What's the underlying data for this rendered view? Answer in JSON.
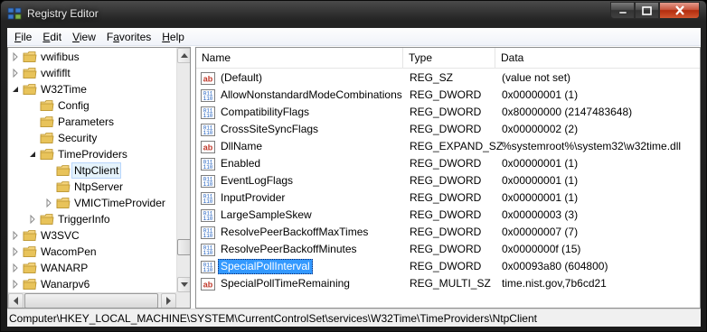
{
  "window": {
    "title": "Registry Editor",
    "caption_buttons": [
      "minimize",
      "maximize",
      "close"
    ]
  },
  "menu": [
    {
      "underline": "F",
      "rest": "ile"
    },
    {
      "underline": "E",
      "rest": "dit"
    },
    {
      "underline": "V",
      "rest": "iew"
    },
    {
      "pre": "F",
      "underline": "a",
      "rest": "vorites"
    },
    {
      "underline": "H",
      "rest": "elp"
    }
  ],
  "tree": {
    "items": [
      {
        "label": "vwifibus",
        "depth": 0,
        "expander": "collapsed"
      },
      {
        "label": "vwififlt",
        "depth": 0,
        "expander": "collapsed"
      },
      {
        "label": "W32Time",
        "depth": 0,
        "expander": "expanded"
      },
      {
        "label": "Config",
        "depth": 1,
        "expander": "none"
      },
      {
        "label": "Parameters",
        "depth": 1,
        "expander": "none"
      },
      {
        "label": "Security",
        "depth": 1,
        "expander": "none"
      },
      {
        "label": "TimeProviders",
        "depth": 1,
        "expander": "expanded"
      },
      {
        "label": "NtpClient",
        "depth": 2,
        "expander": "none",
        "selected": true
      },
      {
        "label": "NtpServer",
        "depth": 2,
        "expander": "none"
      },
      {
        "label": "VMICTimeProvider",
        "depth": 2,
        "expander": "collapsed"
      },
      {
        "label": "TriggerInfo",
        "depth": 1,
        "expander": "collapsed"
      },
      {
        "label": "W3SVC",
        "depth": 0,
        "expander": "collapsed"
      },
      {
        "label": "WacomPen",
        "depth": 0,
        "expander": "collapsed"
      },
      {
        "label": "WANARP",
        "depth": 0,
        "expander": "collapsed"
      },
      {
        "label": "Wanarpv6",
        "depth": 0,
        "expander": "collapsed"
      }
    ]
  },
  "list": {
    "columns": [
      "Name",
      "Type",
      "Data"
    ],
    "rows": [
      {
        "icon": "string-value-icon",
        "name": "(Default)",
        "type": "REG_SZ",
        "data": "(value not set)"
      },
      {
        "icon": "binary-value-icon",
        "name": "AllowNonstandardModeCombinations",
        "type": "REG_DWORD",
        "data": "0x00000001 (1)"
      },
      {
        "icon": "binary-value-icon",
        "name": "CompatibilityFlags",
        "type": "REG_DWORD",
        "data": "0x80000000 (2147483648)"
      },
      {
        "icon": "binary-value-icon",
        "name": "CrossSiteSyncFlags",
        "type": "REG_DWORD",
        "data": "0x00000002 (2)"
      },
      {
        "icon": "string-value-icon",
        "name": "DllName",
        "type": "REG_EXPAND_SZ",
        "data": "%systemroot%\\system32\\w32time.dll"
      },
      {
        "icon": "binary-value-icon",
        "name": "Enabled",
        "type": "REG_DWORD",
        "data": "0x00000001 (1)"
      },
      {
        "icon": "binary-value-icon",
        "name": "EventLogFlags",
        "type": "REG_DWORD",
        "data": "0x00000001 (1)"
      },
      {
        "icon": "binary-value-icon",
        "name": "InputProvider",
        "type": "REG_DWORD",
        "data": "0x00000001 (1)"
      },
      {
        "icon": "binary-value-icon",
        "name": "LargeSampleSkew",
        "type": "REG_DWORD",
        "data": "0x00000003 (3)"
      },
      {
        "icon": "binary-value-icon",
        "name": "ResolvePeerBackoffMaxTimes",
        "type": "REG_DWORD",
        "data": "0x00000007 (7)"
      },
      {
        "icon": "binary-value-icon",
        "name": "ResolvePeerBackoffMinutes",
        "type": "REG_DWORD",
        "data": "0x0000000f (15)"
      },
      {
        "icon": "binary-value-icon",
        "name": "SpecialPollInterval",
        "type": "REG_DWORD",
        "data": "0x00093a80 (604800)",
        "selected": true
      },
      {
        "icon": "string-value-icon",
        "name": "SpecialPollTimeRemaining",
        "type": "REG_MULTI_SZ",
        "data": "time.nist.gov,7b6cd21"
      }
    ]
  },
  "status": {
    "path": "Computer\\HKEY_LOCAL_MACHINE\\SYSTEM\\CurrentControlSet\\services\\W32Time\\TimeProviders\\NtpClient"
  },
  "colors": {
    "selection": "#3399ff",
    "tree_selection": "#e5f3fb",
    "folder": "#e8c35a",
    "string_icon": "#c0392b",
    "binary_icon": "#1f5fbf"
  }
}
